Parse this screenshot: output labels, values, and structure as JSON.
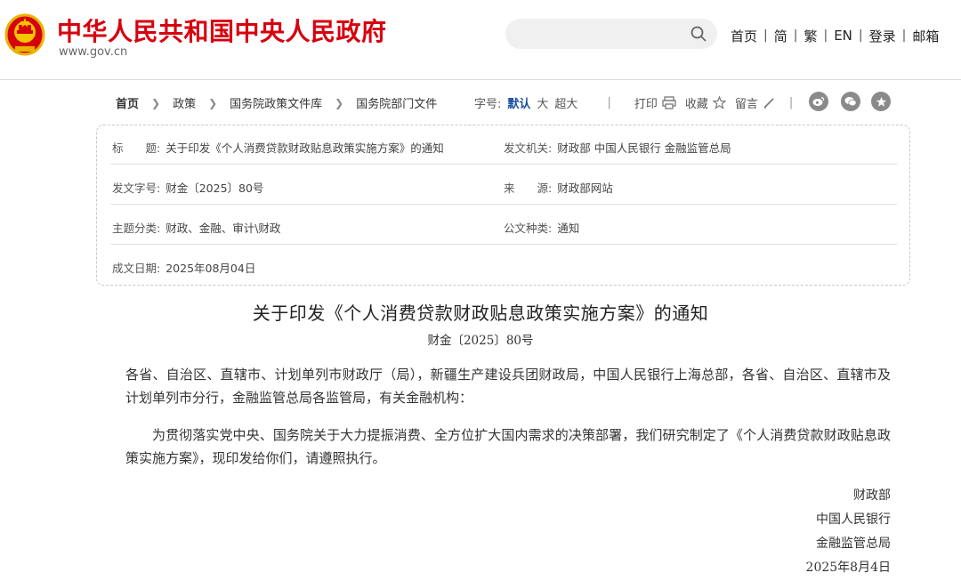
{
  "header": {
    "site_title": "中华人民共和国中央人民政府",
    "site_url": "www.gov.cn",
    "nav": [
      "首页",
      "简",
      "繁",
      "EN",
      "登录",
      "邮箱"
    ]
  },
  "breadcrumb": [
    "首页",
    "政策",
    "国务院政策文件库",
    "国务院部门文件"
  ],
  "toolbar": {
    "font_label": "字号:",
    "font_default": "默认",
    "font_large": "大",
    "font_xlarge": "超大",
    "print": "打印",
    "favorite": "收藏",
    "comment": "留言"
  },
  "info": {
    "title_label": "标　　题:",
    "title_value": "关于印发《个人消费贷款财政贴息政策实施方案》的通知",
    "issuer_label": "发文机关:",
    "issuer_value": "财政部 中国人民银行 金融监管总局",
    "docno_label": "发文字号:",
    "docno_value": "财金〔2025〕80号",
    "source_label": "来　　源:",
    "source_value": "财政部网站",
    "topic_label": "主题分类:",
    "topic_value": "财政、金融、审计\\财政",
    "type_label": "公文种类:",
    "type_value": "通知",
    "date_label": "成文日期:",
    "date_value": "2025年08月04日"
  },
  "article": {
    "title": "关于印发《个人消费贷款财政贴息政策实施方案》的通知",
    "doc_number": "财金〔2025〕80号",
    "para1": "各省、自治区、直辖市、计划单列市财政厅（局），新疆生产建设兵团财政局，中国人民银行上海总部，各省、自治区、直辖市及计划单列市分行，金融监管总局各监管局，有关金融机构：",
    "para2": "为贯彻落实党中央、国务院关于大力提振消费、全方位扩大国内需求的决策部署，我们研究制定了《个人消费贷款财政贴息政策实施方案》，现印发给你们，请遵照执行。",
    "sign1": "财政部",
    "sign2": "中国人民银行",
    "sign3": "金融监管总局",
    "sign_date": "2025年8月4日"
  },
  "colors": {
    "brand_red": "#d7000f",
    "link_blue": "#1a4fa0"
  },
  "icons": [
    "national-emblem",
    "search-icon",
    "print-icon",
    "star-icon",
    "pencil-icon",
    "weibo-icon",
    "wechat-icon",
    "favorite-star-icon"
  ]
}
